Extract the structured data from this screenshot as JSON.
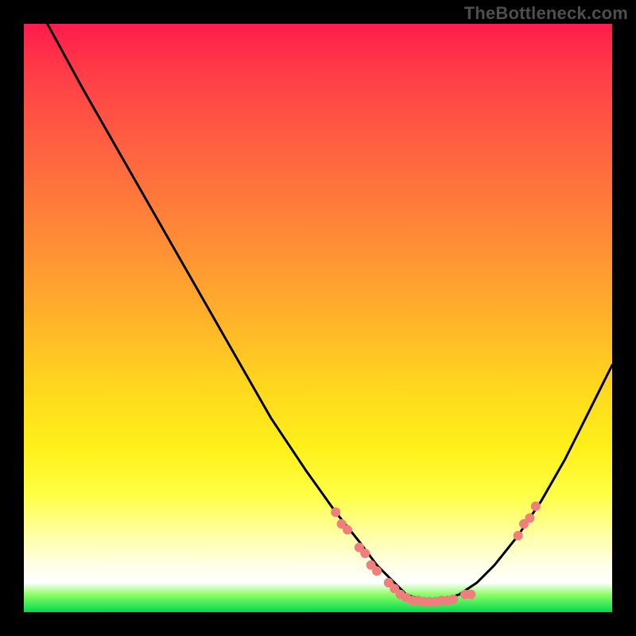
{
  "watermark": "TheBottleneck.com",
  "chart_data": {
    "type": "line",
    "title": "",
    "xlabel": "",
    "ylabel": "",
    "xlim": [
      0,
      100
    ],
    "ylim": [
      0,
      100
    ],
    "grid": false,
    "legend": false,
    "note": "Values are percentages of the plot area; y is plotted inverted (0 at top). The curve depicts a bottleneck dip. Pink markers highlight points near the minimum region.",
    "series": [
      {
        "name": "bottleneck-curve",
        "color": "#000000",
        "x": [
          4,
          10,
          18,
          26,
          34,
          42,
          48,
          53,
          57,
          60,
          63,
          65,
          68,
          71,
          74,
          77,
          80,
          84,
          88,
          92,
          96,
          100
        ],
        "y": [
          0,
          11,
          25,
          39,
          53,
          67,
          76,
          83,
          88,
          92,
          95,
          97,
          98,
          98,
          97,
          95,
          92,
          87,
          81,
          74,
          66,
          58
        ]
      }
    ],
    "markers": {
      "name": "highlight-dots",
      "color": "#ef7f7c",
      "radius_px": 6,
      "points": [
        {
          "x": 53,
          "y": 83
        },
        {
          "x": 54,
          "y": 85
        },
        {
          "x": 55,
          "y": 86
        },
        {
          "x": 57,
          "y": 89
        },
        {
          "x": 58,
          "y": 90
        },
        {
          "x": 59,
          "y": 92
        },
        {
          "x": 60,
          "y": 93
        },
        {
          "x": 62,
          "y": 95
        },
        {
          "x": 63,
          "y": 96
        },
        {
          "x": 64,
          "y": 97
        },
        {
          "x": 65,
          "y": 97.5
        },
        {
          "x": 66,
          "y": 98
        },
        {
          "x": 67,
          "y": 98
        },
        {
          "x": 68,
          "y": 98.2
        },
        {
          "x": 69,
          "y": 98.2
        },
        {
          "x": 70,
          "y": 98.2
        },
        {
          "x": 71,
          "y": 98
        },
        {
          "x": 72,
          "y": 98
        },
        {
          "x": 73,
          "y": 97.8
        },
        {
          "x": 75,
          "y": 97
        },
        {
          "x": 76,
          "y": 97
        },
        {
          "x": 84,
          "y": 87
        },
        {
          "x": 85,
          "y": 85
        },
        {
          "x": 86,
          "y": 84
        },
        {
          "x": 87,
          "y": 82
        }
      ]
    }
  }
}
